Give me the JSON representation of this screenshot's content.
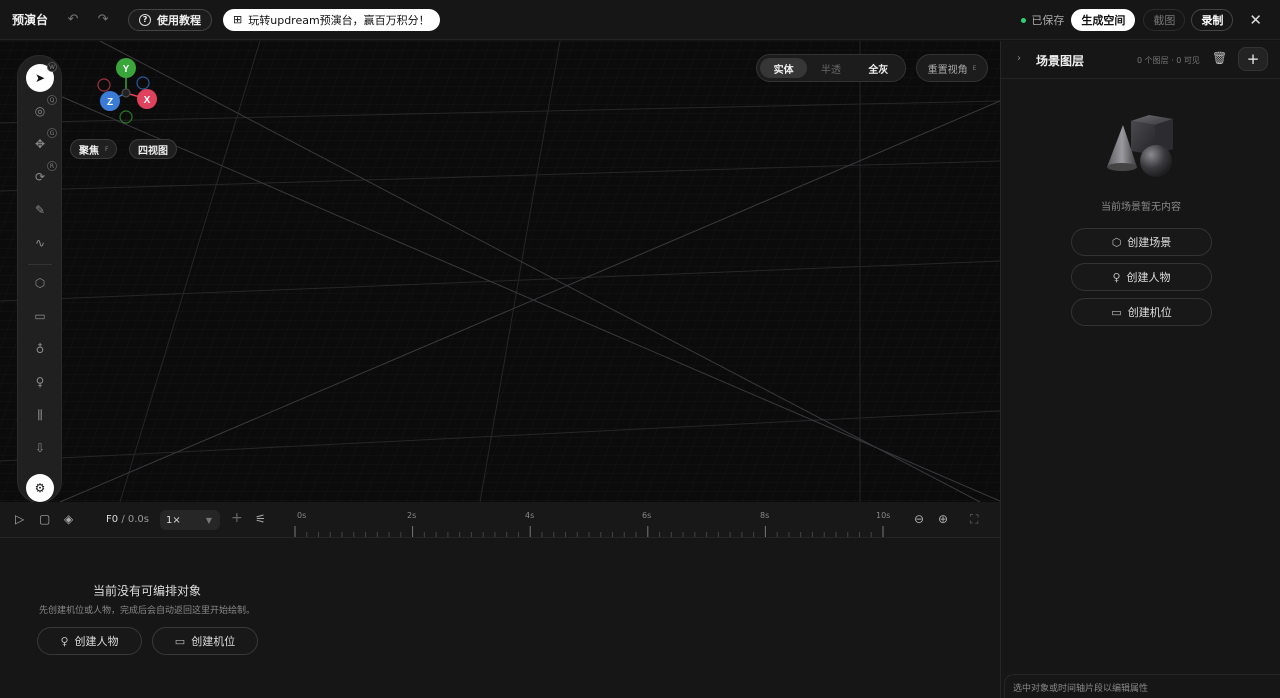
{
  "header": {
    "title": "预演台",
    "tutorial_label": "使用教程",
    "promo_label": "玩转updream预演台，赢百万积分！",
    "saved_label": "已保存",
    "generate_label": "生成空间",
    "screenshot_label": "截图",
    "record_label": "录制"
  },
  "toolbar": {
    "keys": [
      "W",
      "Q",
      "G",
      "R"
    ]
  },
  "gizmo": {
    "y": "Y",
    "z": "Z",
    "x": "X"
  },
  "view": {
    "focus_label": "聚焦",
    "focus_key": "F",
    "quad_label": "四视图",
    "modes": [
      "实体",
      "半透",
      "全灰"
    ],
    "reset_label": "重置视角",
    "reset_key": "E"
  },
  "timeline": {
    "frame": "F0",
    "time": "0.0s",
    "speed": "1×",
    "ticks": [
      "0s",
      "2s",
      "4s",
      "6s",
      "8s",
      "10s"
    ],
    "empty_title": "当前没有可编排对象",
    "empty_sub": "先创建机位或人物，完成后会自动返回这里开始绘制。",
    "create_person_label": "创建人物",
    "create_camera_label": "创建机位"
  },
  "panel": {
    "title": "场景图层",
    "count": "0 个图层 · 0 可见",
    "empty_text": "当前场景暂无内容",
    "create_scene_label": "创建场景",
    "create_person_label": "创建人物",
    "create_camera_label": "创建机位",
    "props_hint": "选中对象或时间轴片段以编辑属性"
  },
  "colors": {
    "axis_x": "#e0415c",
    "axis_y": "#3aa53a",
    "axis_z": "#3a7bd5",
    "saved_dot": "#2fd07a"
  }
}
